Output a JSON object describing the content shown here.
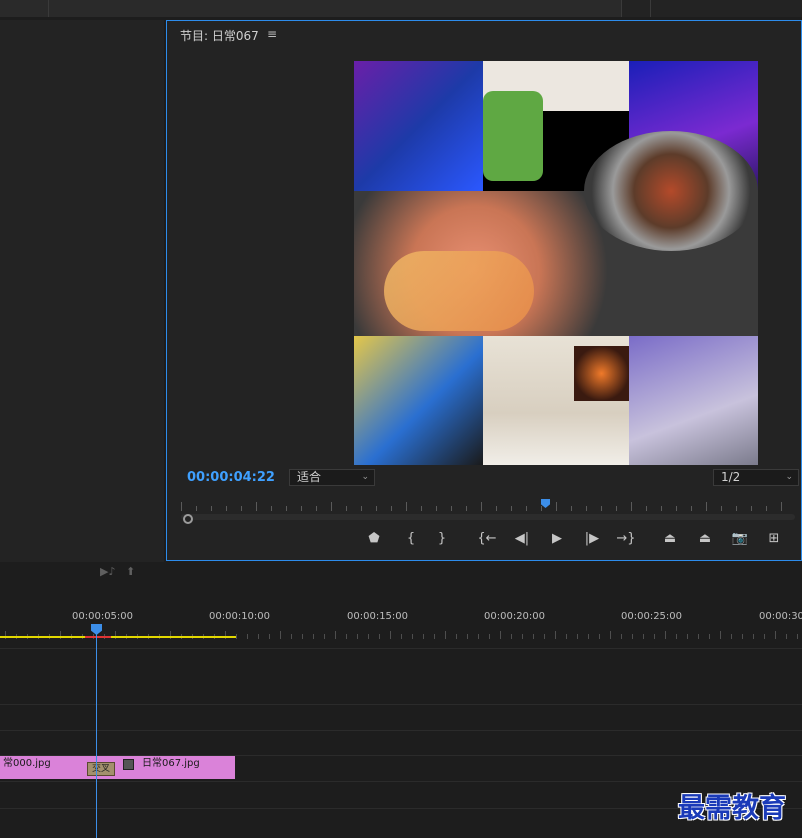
{
  "program_monitor": {
    "title": "节目: 日常067",
    "menu_icon": "≡",
    "timecode": "00:00:04:22",
    "fit_select": "适合",
    "resolution_select": "1/2"
  },
  "controls": [
    {
      "name": "add-marker-button",
      "glyph": "⬟"
    },
    {
      "name": "mark-in-button",
      "glyph": "{"
    },
    {
      "name": "mark-out-button",
      "glyph": "}"
    },
    {
      "name": "go-to-in-button",
      "glyph": "{←"
    },
    {
      "name": "step-back-button",
      "glyph": "◀|"
    },
    {
      "name": "play-button",
      "glyph": "▶"
    },
    {
      "name": "step-forward-button",
      "glyph": "|▶"
    },
    {
      "name": "go-to-out-button",
      "glyph": "→}"
    },
    {
      "name": "lift-button",
      "glyph": "⏏"
    },
    {
      "name": "extract-button",
      "glyph": "⏏"
    },
    {
      "name": "export-frame-button",
      "glyph": "📷"
    },
    {
      "name": "button-editor-button",
      "glyph": "⊞"
    }
  ],
  "timeline": {
    "ruler_labels": [
      "00:00:05:00",
      "00:00:10:00",
      "00:00:15:00",
      "00:00:20:00",
      "00:00:25:00",
      "00:00:30"
    ],
    "clips": [
      {
        "label": "常000.jpg"
      },
      {
        "label": "日常067.jpg"
      }
    ],
    "transition_label": "交叉"
  },
  "watermark": "最需教育",
  "colors": {
    "accent": "#2d8ceb",
    "clip": "#da82d9",
    "workarea": "#e2d800"
  }
}
